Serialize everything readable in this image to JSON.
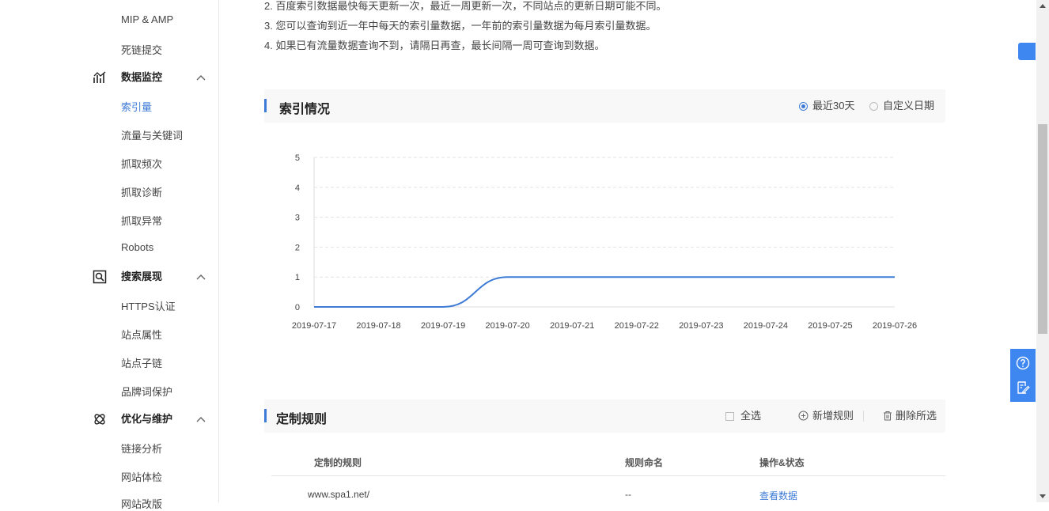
{
  "sidebar": {
    "top_items": [
      "MIP & AMP",
      "死链提交"
    ],
    "groups": [
      {
        "label": "数据监控",
        "icon": "chart-line-icon",
        "items": [
          "索引量",
          "流量与关键词",
          "抓取频次",
          "抓取诊断",
          "抓取异常",
          "Robots"
        ]
      },
      {
        "label": "搜索展现",
        "icon": "search-display-icon",
        "items": [
          "HTTPS认证",
          "站点属性",
          "站点子链",
          "品牌词保护"
        ]
      },
      {
        "label": "优化与维护",
        "icon": "optimize-icon",
        "items": [
          "链接分析",
          "网站体检",
          "网站改版"
        ]
      }
    ],
    "active_item": "索引量"
  },
  "notes": [
    "2. 百度索引数据最快每天更新一次，最近一周更新一次，不同站点的更新日期可能不同。",
    "3. 您可以查询到近一年中每天的索引量数据，一年前的索引量数据为每月索引量数据。",
    "4. 如果已有流量数据查询不到，请隔日再查，最长间隔一周可查询到数据。"
  ],
  "index_panel": {
    "title": "索引情况",
    "radio_recent": "最近30天",
    "radio_custom": "自定义日期",
    "selected": "recent"
  },
  "chart_data": {
    "type": "line",
    "x": [
      "2019-07-17",
      "2019-07-18",
      "2019-07-19",
      "2019-07-20",
      "2019-07-21",
      "2019-07-22",
      "2019-07-23",
      "2019-07-24",
      "2019-07-25",
      "2019-07-26"
    ],
    "series": [
      {
        "values": [
          0,
          0,
          0,
          1,
          1,
          1,
          1,
          1,
          1,
          1
        ]
      }
    ],
    "yticks": [
      0,
      1,
      2,
      3,
      4,
      5
    ],
    "ylim": [
      0,
      5
    ],
    "grid": true,
    "color": "#3e7bd6"
  },
  "rules_panel": {
    "title": "定制规则",
    "select_all": "全选",
    "add_rule": "新增规则",
    "delete_selected": "删除所选",
    "columns": [
      "定制的规则",
      "规则命名",
      "操作&状态"
    ],
    "rows": [
      {
        "rule": "www.spa1.net/",
        "name": "--",
        "action": "查看数据"
      }
    ]
  }
}
